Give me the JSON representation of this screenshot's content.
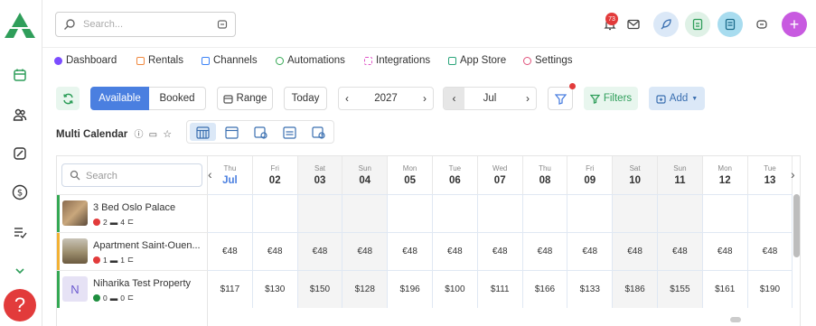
{
  "search": {
    "placeholder": "Search..."
  },
  "notifications": {
    "count": "73"
  },
  "nav": [
    {
      "label": "Dashboard",
      "color": "#7c4dff"
    },
    {
      "label": "Rentals",
      "color": "#f0883e"
    },
    {
      "label": "Channels",
      "color": "#3b82f6"
    },
    {
      "label": "Automations",
      "color": "#34a853"
    },
    {
      "label": "Integrations",
      "color": "#e056c8"
    },
    {
      "label": "App Store",
      "color": "#2aa57a"
    },
    {
      "label": "Settings",
      "color": "#e0507a"
    }
  ],
  "toolbar": {
    "available": "Available",
    "booked": "Booked",
    "range": "Range",
    "today": "Today",
    "year": "2027",
    "month": "Jul",
    "filters": "Filters",
    "add": "Add"
  },
  "calendar": {
    "title": "Multi Calendar",
    "search_placeholder": "Search",
    "days": [
      {
        "dow": "Thu",
        "num": "Jul",
        "highlight": true,
        "weekend": false
      },
      {
        "dow": "Fri",
        "num": "02",
        "weekend": false
      },
      {
        "dow": "Sat",
        "num": "03",
        "weekend": true
      },
      {
        "dow": "Sun",
        "num": "04",
        "weekend": true
      },
      {
        "dow": "Mon",
        "num": "05",
        "weekend": false
      },
      {
        "dow": "Tue",
        "num": "06",
        "weekend": false
      },
      {
        "dow": "Wed",
        "num": "07",
        "weekend": false
      },
      {
        "dow": "Thu",
        "num": "08",
        "weekend": false
      },
      {
        "dow": "Fri",
        "num": "09",
        "weekend": false
      },
      {
        "dow": "Sat",
        "num": "10",
        "weekend": true
      },
      {
        "dow": "Sun",
        "num": "11",
        "weekend": true
      },
      {
        "dow": "Mon",
        "num": "12",
        "weekend": false
      },
      {
        "dow": "Tue",
        "num": "13",
        "weekend": false
      }
    ],
    "properties": [
      {
        "name": "3 Bed Oslo Palace",
        "beds": "2",
        "baths": "4",
        "status_color": "#e23b3b",
        "bar_color": "#34a853",
        "thumb": "photo",
        "prices": [
          "",
          "",
          "",
          "",
          "",
          "",
          "",
          "",
          "",
          "",
          "",
          "",
          ""
        ]
      },
      {
        "name": "Apartment Saint-Ouen...",
        "beds": "1",
        "baths": "1",
        "status_color": "#e23b3b",
        "bar_color": "#f2b134",
        "thumb": "photo",
        "prices": [
          "€48",
          "€48",
          "€48",
          "€48",
          "€48",
          "€48",
          "€48",
          "€48",
          "€48",
          "€48",
          "€48",
          "€48",
          "€48"
        ]
      },
      {
        "name": "Niharika Test Property",
        "beds": "0",
        "baths": "0",
        "status_color": "#1e8e3e",
        "bar_color": "#34a853",
        "thumb": "N",
        "prices": [
          "$117",
          "$130",
          "$150",
          "$128",
          "$196",
          "$100",
          "$111",
          "$166",
          "$133",
          "$186",
          "$155",
          "$161",
          "$190"
        ]
      }
    ]
  }
}
